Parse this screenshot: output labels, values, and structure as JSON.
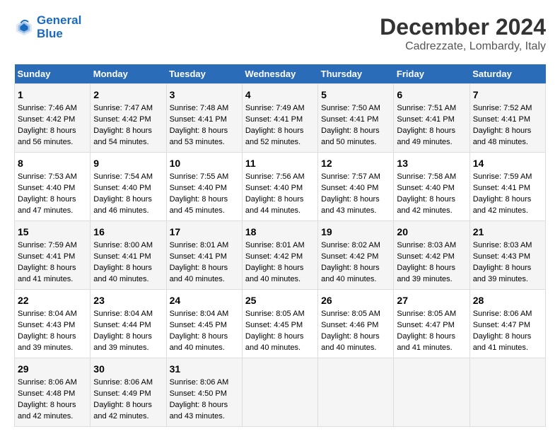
{
  "header": {
    "logo_line1": "General",
    "logo_line2": "Blue",
    "title": "December 2024",
    "subtitle": "Cadrezzate, Lombardy, Italy"
  },
  "calendar": {
    "days_of_week": [
      "Sunday",
      "Monday",
      "Tuesday",
      "Wednesday",
      "Thursday",
      "Friday",
      "Saturday"
    ],
    "weeks": [
      [
        {
          "day": "1",
          "sunrise": "Sunrise: 7:46 AM",
          "sunset": "Sunset: 4:42 PM",
          "daylight": "Daylight: 8 hours and 56 minutes."
        },
        {
          "day": "2",
          "sunrise": "Sunrise: 7:47 AM",
          "sunset": "Sunset: 4:42 PM",
          "daylight": "Daylight: 8 hours and 54 minutes."
        },
        {
          "day": "3",
          "sunrise": "Sunrise: 7:48 AM",
          "sunset": "Sunset: 4:41 PM",
          "daylight": "Daylight: 8 hours and 53 minutes."
        },
        {
          "day": "4",
          "sunrise": "Sunrise: 7:49 AM",
          "sunset": "Sunset: 4:41 PM",
          "daylight": "Daylight: 8 hours and 52 minutes."
        },
        {
          "day": "5",
          "sunrise": "Sunrise: 7:50 AM",
          "sunset": "Sunset: 4:41 PM",
          "daylight": "Daylight: 8 hours and 50 minutes."
        },
        {
          "day": "6",
          "sunrise": "Sunrise: 7:51 AM",
          "sunset": "Sunset: 4:41 PM",
          "daylight": "Daylight: 8 hours and 49 minutes."
        },
        {
          "day": "7",
          "sunrise": "Sunrise: 7:52 AM",
          "sunset": "Sunset: 4:41 PM",
          "daylight": "Daylight: 8 hours and 48 minutes."
        }
      ],
      [
        {
          "day": "8",
          "sunrise": "Sunrise: 7:53 AM",
          "sunset": "Sunset: 4:40 PM",
          "daylight": "Daylight: 8 hours and 47 minutes."
        },
        {
          "day": "9",
          "sunrise": "Sunrise: 7:54 AM",
          "sunset": "Sunset: 4:40 PM",
          "daylight": "Daylight: 8 hours and 46 minutes."
        },
        {
          "day": "10",
          "sunrise": "Sunrise: 7:55 AM",
          "sunset": "Sunset: 4:40 PM",
          "daylight": "Daylight: 8 hours and 45 minutes."
        },
        {
          "day": "11",
          "sunrise": "Sunrise: 7:56 AM",
          "sunset": "Sunset: 4:40 PM",
          "daylight": "Daylight: 8 hours and 44 minutes."
        },
        {
          "day": "12",
          "sunrise": "Sunrise: 7:57 AM",
          "sunset": "Sunset: 4:40 PM",
          "daylight": "Daylight: 8 hours and 43 minutes."
        },
        {
          "day": "13",
          "sunrise": "Sunrise: 7:58 AM",
          "sunset": "Sunset: 4:40 PM",
          "daylight": "Daylight: 8 hours and 42 minutes."
        },
        {
          "day": "14",
          "sunrise": "Sunrise: 7:59 AM",
          "sunset": "Sunset: 4:41 PM",
          "daylight": "Daylight: 8 hours and 42 minutes."
        }
      ],
      [
        {
          "day": "15",
          "sunrise": "Sunrise: 7:59 AM",
          "sunset": "Sunset: 4:41 PM",
          "daylight": "Daylight: 8 hours and 41 minutes."
        },
        {
          "day": "16",
          "sunrise": "Sunrise: 8:00 AM",
          "sunset": "Sunset: 4:41 PM",
          "daylight": "Daylight: 8 hours and 40 minutes."
        },
        {
          "day": "17",
          "sunrise": "Sunrise: 8:01 AM",
          "sunset": "Sunset: 4:41 PM",
          "daylight": "Daylight: 8 hours and 40 minutes."
        },
        {
          "day": "18",
          "sunrise": "Sunrise: 8:01 AM",
          "sunset": "Sunset: 4:42 PM",
          "daylight": "Daylight: 8 hours and 40 minutes."
        },
        {
          "day": "19",
          "sunrise": "Sunrise: 8:02 AM",
          "sunset": "Sunset: 4:42 PM",
          "daylight": "Daylight: 8 hours and 40 minutes."
        },
        {
          "day": "20",
          "sunrise": "Sunrise: 8:03 AM",
          "sunset": "Sunset: 4:42 PM",
          "daylight": "Daylight: 8 hours and 39 minutes."
        },
        {
          "day": "21",
          "sunrise": "Sunrise: 8:03 AM",
          "sunset": "Sunset: 4:43 PM",
          "daylight": "Daylight: 8 hours and 39 minutes."
        }
      ],
      [
        {
          "day": "22",
          "sunrise": "Sunrise: 8:04 AM",
          "sunset": "Sunset: 4:43 PM",
          "daylight": "Daylight: 8 hours and 39 minutes."
        },
        {
          "day": "23",
          "sunrise": "Sunrise: 8:04 AM",
          "sunset": "Sunset: 4:44 PM",
          "daylight": "Daylight: 8 hours and 39 minutes."
        },
        {
          "day": "24",
          "sunrise": "Sunrise: 8:04 AM",
          "sunset": "Sunset: 4:45 PM",
          "daylight": "Daylight: 8 hours and 40 minutes."
        },
        {
          "day": "25",
          "sunrise": "Sunrise: 8:05 AM",
          "sunset": "Sunset: 4:45 PM",
          "daylight": "Daylight: 8 hours and 40 minutes."
        },
        {
          "day": "26",
          "sunrise": "Sunrise: 8:05 AM",
          "sunset": "Sunset: 4:46 PM",
          "daylight": "Daylight: 8 hours and 40 minutes."
        },
        {
          "day": "27",
          "sunrise": "Sunrise: 8:05 AM",
          "sunset": "Sunset: 4:47 PM",
          "daylight": "Daylight: 8 hours and 41 minutes."
        },
        {
          "day": "28",
          "sunrise": "Sunrise: 8:06 AM",
          "sunset": "Sunset: 4:47 PM",
          "daylight": "Daylight: 8 hours and 41 minutes."
        }
      ],
      [
        {
          "day": "29",
          "sunrise": "Sunrise: 8:06 AM",
          "sunset": "Sunset: 4:48 PM",
          "daylight": "Daylight: 8 hours and 42 minutes."
        },
        {
          "day": "30",
          "sunrise": "Sunrise: 8:06 AM",
          "sunset": "Sunset: 4:49 PM",
          "daylight": "Daylight: 8 hours and 42 minutes."
        },
        {
          "day": "31",
          "sunrise": "Sunrise: 8:06 AM",
          "sunset": "Sunset: 4:50 PM",
          "daylight": "Daylight: 8 hours and 43 minutes."
        },
        null,
        null,
        null,
        null
      ]
    ]
  }
}
